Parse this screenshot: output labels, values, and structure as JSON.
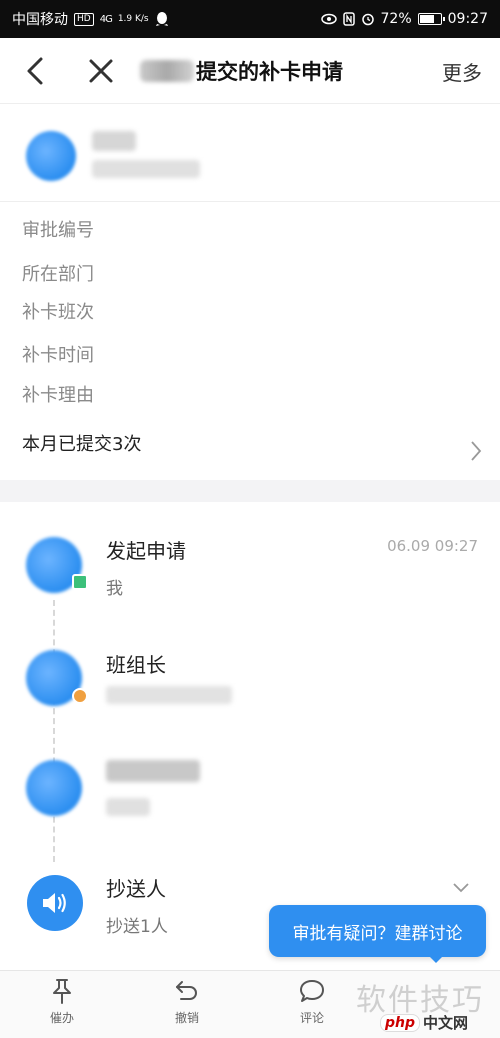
{
  "status_bar": {
    "carrier": "中国移动",
    "hd": "HD",
    "signal": "4G",
    "speed": "1.9 K/s",
    "battery": "72%",
    "battery_level": 0.72,
    "time": "09:27"
  },
  "nav": {
    "title_suffix": "提交的补卡申请",
    "more_label": "更多"
  },
  "fields": {
    "approval_no": "审批编号",
    "department": "所在部门",
    "shift": "补卡班次",
    "time": "补卡时间",
    "reason": "补卡理由",
    "monthly": "本月已提交3次"
  },
  "timeline": {
    "step1": {
      "title": "发起申请",
      "sub": "我",
      "time": "06.09 09:27"
    },
    "step2": {
      "title": "班组长"
    },
    "cc": {
      "title": "抄送人",
      "sub": "抄送1人"
    }
  },
  "tooltip": {
    "text": "审批有疑问？建群讨论"
  },
  "bottom_bar": {
    "urge": "催办",
    "revoke": "撤销",
    "comment": "评论"
  },
  "watermark": {
    "main": "软件技巧",
    "php_logo": "php",
    "php_text": "中文网"
  },
  "colors": {
    "accent": "#2f8ff0",
    "status_bar": "#0d0d0d",
    "badge_orange": "#f0a040",
    "badge_green": "#3cc07a"
  }
}
